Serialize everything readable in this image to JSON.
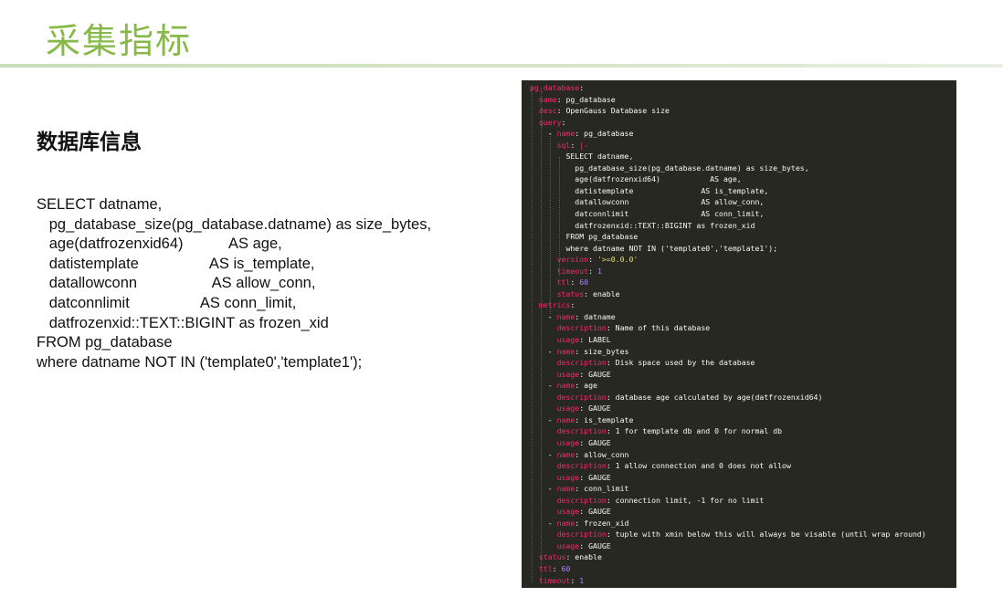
{
  "header": {
    "title": "采集指标"
  },
  "left": {
    "heading": "数据库信息",
    "sql_lines": [
      "SELECT datname,",
      "   pg_database_size(pg_database.datname) as size_bytes,",
      "   age(datfrozenxid64)           AS age,",
      "   datistemplate                 AS is_template,",
      "   datallowconn                  AS allow_conn,",
      "   datconnlimit                 AS conn_limit,",
      "   datfrozenxid::TEXT::BIGINT as frozen_xid",
      "FROM pg_database",
      "where datname NOT IN ('template0','template1');"
    ]
  },
  "code": {
    "lines": [
      {
        "indent": "",
        "key": "pg_database",
        "sep": ":",
        "val": "",
        "vt": "v"
      },
      {
        "indent": "  ",
        "key": "name",
        "sep": ": ",
        "val": "pg_database",
        "vt": "v"
      },
      {
        "indent": "  ",
        "key": "desc",
        "sep": ": ",
        "val": "OpenGauss Database size",
        "vt": "v"
      },
      {
        "indent": "  ",
        "key": "query",
        "sep": ":",
        "val": "",
        "vt": "v"
      },
      {
        "indent": "    - ",
        "key": "name",
        "sep": ": ",
        "val": "pg_database",
        "vt": "v"
      },
      {
        "indent": "      ",
        "key": "sql",
        "sep": ": ",
        "val": "|-",
        "vt": "k"
      },
      {
        "indent": "        ",
        "key": "",
        "sep": "",
        "val": "SELECT datname,",
        "vt": "v"
      },
      {
        "indent": "          ",
        "key": "",
        "sep": "",
        "val": "pg_database_size(pg_database.datname) as size_bytes,",
        "vt": "v"
      },
      {
        "indent": "          ",
        "key": "",
        "sep": "",
        "val": "age(datfrozenxid64)           AS age,",
        "vt": "v"
      },
      {
        "indent": "          ",
        "key": "",
        "sep": "",
        "val": "datistemplate               AS is_template,",
        "vt": "v"
      },
      {
        "indent": "          ",
        "key": "",
        "sep": "",
        "val": "datallowconn                AS allow_conn,",
        "vt": "v"
      },
      {
        "indent": "          ",
        "key": "",
        "sep": "",
        "val": "datconnlimit                AS conn_limit,",
        "vt": "v"
      },
      {
        "indent": "          ",
        "key": "",
        "sep": "",
        "val": "datfrozenxid::TEXT::BIGINT as frozen_xid",
        "vt": "v"
      },
      {
        "indent": "        ",
        "key": "",
        "sep": "",
        "val": "FROM pg_database",
        "vt": "v"
      },
      {
        "indent": "        ",
        "key": "",
        "sep": "",
        "val": "where datname NOT IN ('template0','template1');",
        "vt": "v"
      },
      {
        "indent": "      ",
        "key": "version",
        "sep": ": ",
        "val": "'>=0.0.0'",
        "vt": "s"
      },
      {
        "indent": "      ",
        "key": "timeout",
        "sep": ": ",
        "val": "1",
        "vt": "n"
      },
      {
        "indent": "      ",
        "key": "ttl",
        "sep": ": ",
        "val": "60",
        "vt": "n"
      },
      {
        "indent": "      ",
        "key": "status",
        "sep": ": ",
        "val": "enable",
        "vt": "v"
      },
      {
        "indent": "  ",
        "key": "metrics",
        "sep": ":",
        "val": "",
        "vt": "v"
      },
      {
        "indent": "    - ",
        "key": "name",
        "sep": ": ",
        "val": "datname",
        "vt": "v"
      },
      {
        "indent": "      ",
        "key": "description",
        "sep": ": ",
        "val": "Name of this database",
        "vt": "v"
      },
      {
        "indent": "      ",
        "key": "usage",
        "sep": ": ",
        "val": "LABEL",
        "vt": "v"
      },
      {
        "indent": "    - ",
        "key": "name",
        "sep": ": ",
        "val": "size_bytes",
        "vt": "v"
      },
      {
        "indent": "      ",
        "key": "description",
        "sep": ": ",
        "val": "Disk space used by the database",
        "vt": "v"
      },
      {
        "indent": "      ",
        "key": "usage",
        "sep": ": ",
        "val": "GAUGE",
        "vt": "v"
      },
      {
        "indent": "    - ",
        "key": "name",
        "sep": ": ",
        "val": "age",
        "vt": "v"
      },
      {
        "indent": "      ",
        "key": "description",
        "sep": ": ",
        "val": "database age calculated by age(datfrozenxid64)",
        "vt": "v"
      },
      {
        "indent": "      ",
        "key": "usage",
        "sep": ": ",
        "val": "GAUGE",
        "vt": "v"
      },
      {
        "indent": "    - ",
        "key": "name",
        "sep": ": ",
        "val": "is_template",
        "vt": "v"
      },
      {
        "indent": "      ",
        "key": "description",
        "sep": ": ",
        "val": "1 for template db and 0 for normal db",
        "vt": "v"
      },
      {
        "indent": "      ",
        "key": "usage",
        "sep": ": ",
        "val": "GAUGE",
        "vt": "v"
      },
      {
        "indent": "    - ",
        "key": "name",
        "sep": ": ",
        "val": "allow_conn",
        "vt": "v"
      },
      {
        "indent": "      ",
        "key": "description",
        "sep": ": ",
        "val": "1 allow connection and 0 does not allow",
        "vt": "v"
      },
      {
        "indent": "      ",
        "key": "usage",
        "sep": ": ",
        "val": "GAUGE",
        "vt": "v"
      },
      {
        "indent": "    - ",
        "key": "name",
        "sep": ": ",
        "val": "conn_limit",
        "vt": "v"
      },
      {
        "indent": "      ",
        "key": "description",
        "sep": ": ",
        "val": "connection limit, -1 for no limit",
        "vt": "v"
      },
      {
        "indent": "      ",
        "key": "usage",
        "sep": ": ",
        "val": "GAUGE",
        "vt": "v"
      },
      {
        "indent": "    - ",
        "key": "name",
        "sep": ": ",
        "val": "frozen_xid",
        "vt": "v"
      },
      {
        "indent": "      ",
        "key": "description",
        "sep": ": ",
        "val": "tuple with xmin below this will always be visable (until wrap around)",
        "vt": "v"
      },
      {
        "indent": "      ",
        "key": "usage",
        "sep": ": ",
        "val": "GAUGE",
        "vt": "v"
      },
      {
        "indent": "  ",
        "key": "status",
        "sep": ": ",
        "val": "enable",
        "vt": "v"
      },
      {
        "indent": "  ",
        "key": "ttl",
        "sep": ": ",
        "val": "60",
        "vt": "n"
      },
      {
        "indent": "  ",
        "key": "timeout",
        "sep": ": ",
        "val": "1",
        "vt": "n"
      }
    ]
  },
  "colors": {
    "title_green": "#86b947",
    "code_bg": "#272822",
    "yaml_key": "#f92672",
    "yaml_number": "#ae81ff",
    "yaml_string": "#e6db74",
    "yaml_text": "#f8f8f2"
  }
}
